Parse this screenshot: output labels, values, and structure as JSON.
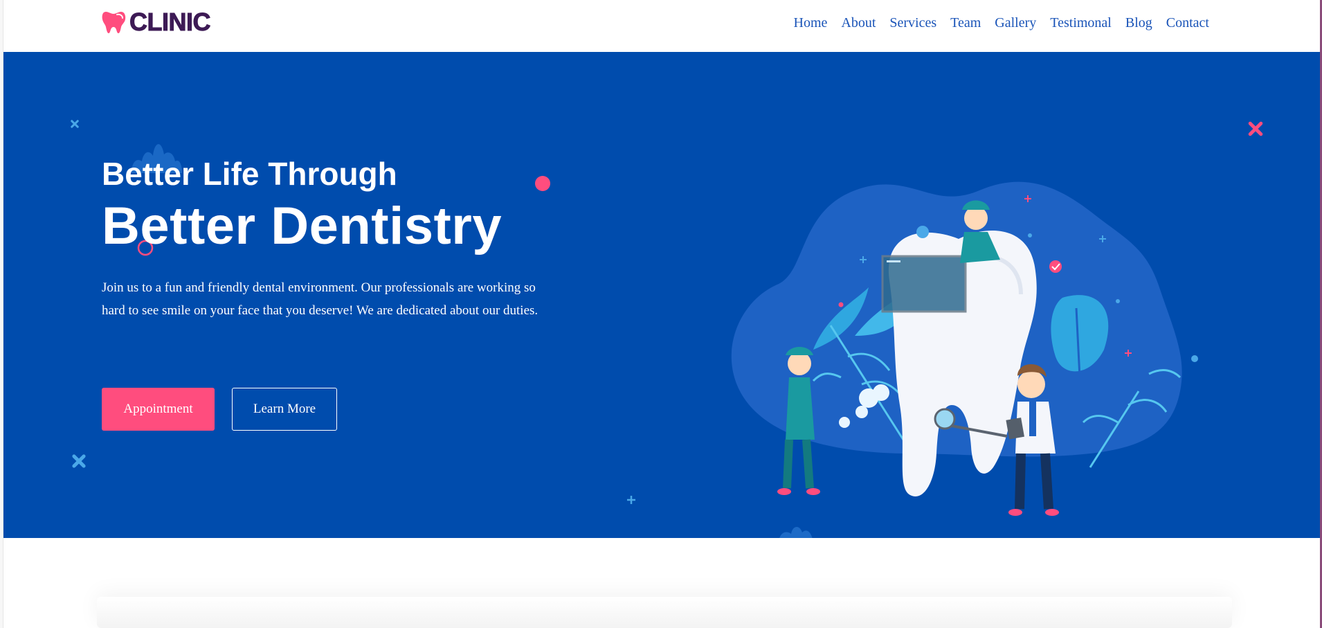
{
  "brand": {
    "name": "CLINIC",
    "logo_icon": "tooth-icon",
    "accent": "#ff4d7e",
    "text_color": "#3d1a55"
  },
  "nav": {
    "items": [
      {
        "label": "Home"
      },
      {
        "label": "About"
      },
      {
        "label": "Services"
      },
      {
        "label": "Team"
      },
      {
        "label": "Gallery"
      },
      {
        "label": "Testimonal"
      },
      {
        "label": "Blog"
      },
      {
        "label": "Contact"
      }
    ],
    "link_color": "#1a54b8"
  },
  "hero": {
    "background": "#004cad",
    "kicker": "Better Life Through",
    "headline": "Better Dentistry",
    "description": "Join us to a fun and friendly dental environment. Our professionals are working so hard to see smile on your face that you deserve! We are dedicated about our duties.",
    "primary_button": "Appointment",
    "secondary_button": "Learn More"
  }
}
